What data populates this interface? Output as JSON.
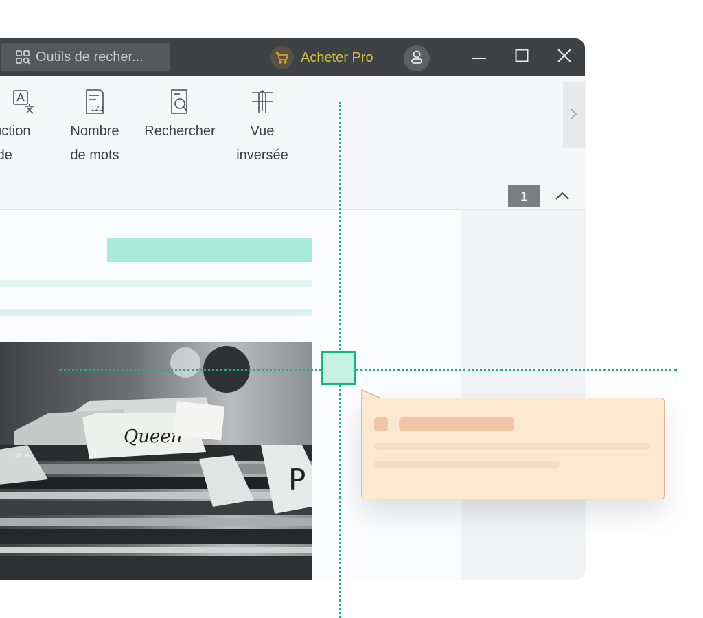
{
  "titlebar": {
    "search_placeholder": "Outils de recher...",
    "buy_pro_label": "Acheter Pro",
    "buy_pro_color": "#d6c03b"
  },
  "ribbon": {
    "items": [
      {
        "label": "duction\npide",
        "icon": "translate-icon"
      },
      {
        "label": "Nombre\nde mots",
        "icon": "word-count-icon"
      },
      {
        "label": "Rechercher",
        "icon": "search-document-icon"
      },
      {
        "label": "Vue\ninversée",
        "icon": "reverse-view-icon"
      }
    ],
    "page_number": "1"
  },
  "photo": {
    "tab_label": "Queen",
    "record_label": "SIDE A"
  },
  "colors": {
    "accent_green": "#15b583",
    "highlight": "#a8ecd8",
    "callout_bg": "#fde9cf",
    "titlebar_bg": "#3f4244"
  }
}
